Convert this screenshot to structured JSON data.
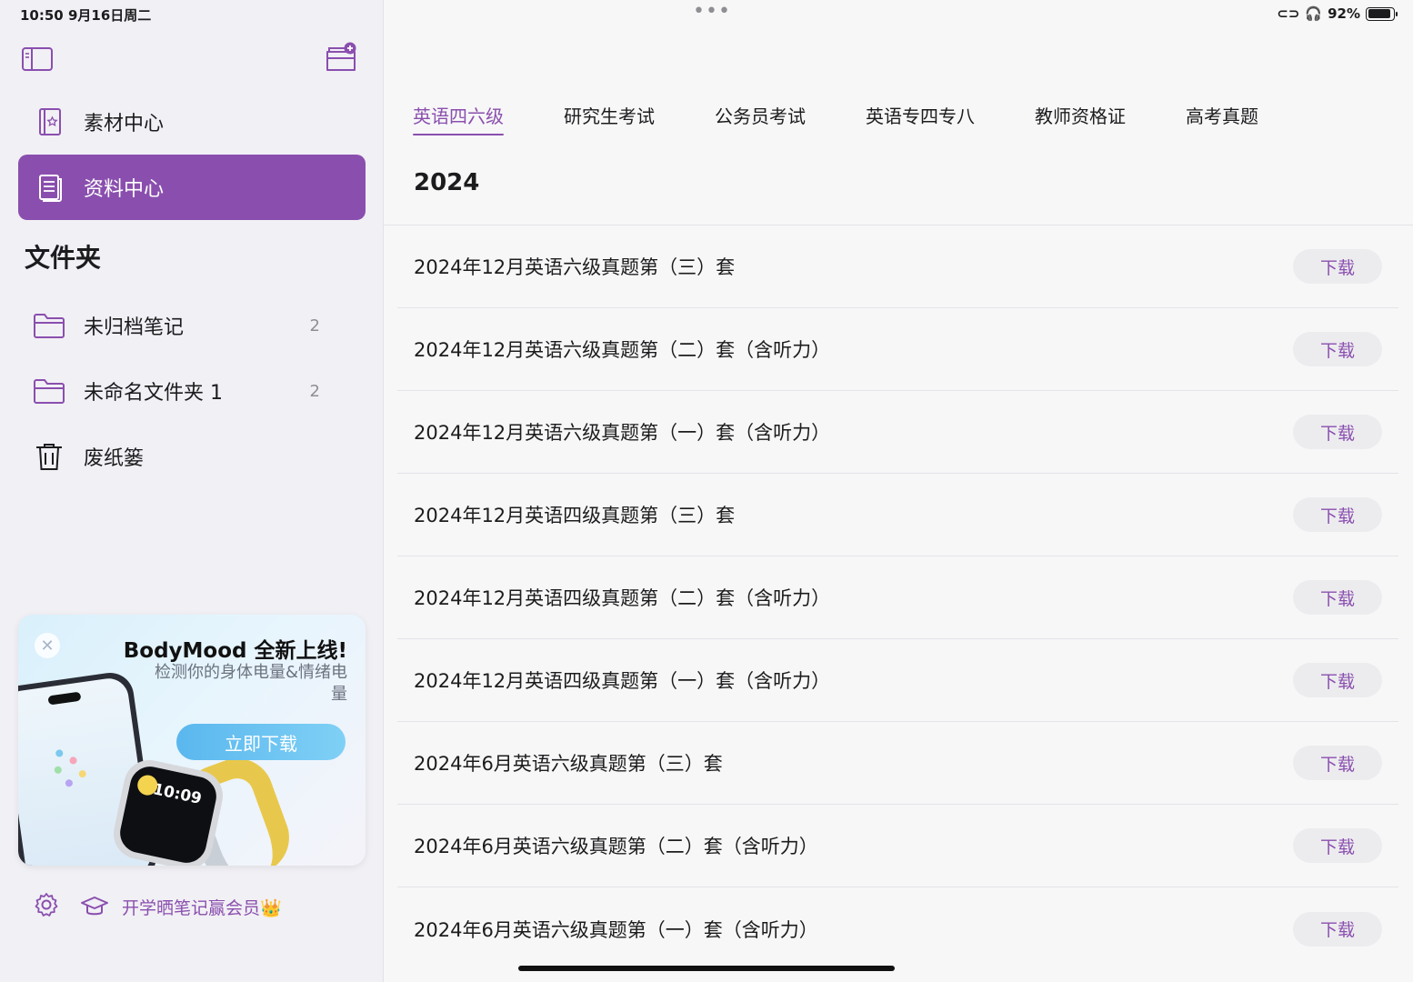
{
  "status_bar": {
    "time_date": "10:50   9月16日周二",
    "battery_text": "92%",
    "battery_level": 0.92
  },
  "sidebar": {
    "nav": [
      {
        "label": "素材中心",
        "icon": "material-book-icon",
        "active": false
      },
      {
        "label": "资料中心",
        "icon": "document-icon",
        "active": true
      }
    ],
    "folders_title": "文件夹",
    "folders": [
      {
        "label": "未归档笔记",
        "count": "2",
        "icon": "folder-icon"
      },
      {
        "label": "未命名文件夹 1",
        "count": "2",
        "icon": "folder-icon"
      },
      {
        "label": "废纸篓",
        "count": "",
        "icon": "trash-icon"
      }
    ],
    "promo": {
      "title": "BodyMood 全新上线!",
      "subtitle": "检测你的身体电量&情绪电量",
      "button": "立即下载",
      "watch_time": "10:09"
    },
    "footer_link": "开学晒笔记赢会员👑"
  },
  "main": {
    "tabs": [
      "英语四六级",
      "研究生考试",
      "公务员考试",
      "英语专四专八",
      "教师资格证",
      "高考真题"
    ],
    "active_tab": 0,
    "year": "2024",
    "download_label": "下载",
    "items": [
      "2024年12月英语六级真题第（三）套",
      "2024年12月英语六级真题第（二）套（含听力）",
      "2024年12月英语六级真题第（一）套（含听力）",
      "2024年12月英语四级真题第（三）套",
      "2024年12月英语四级真题第（二）套（含听力）",
      "2024年12月英语四级真题第（一）套（含听力）",
      "2024年6月英语六级真题第（三）套",
      "2024年6月英语六级真题第（二）套（含听力）",
      "2024年6月英语六级真题第（一）套（含听力）"
    ]
  },
  "colors": {
    "accent": "#8a4fae",
    "sidebar_bg": "#f1f0f5",
    "main_bg": "#f7f7f8"
  }
}
